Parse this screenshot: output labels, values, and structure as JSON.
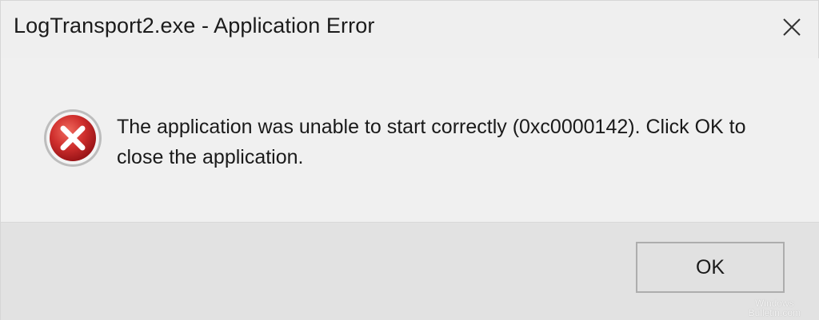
{
  "window": {
    "title": "LogTransport2.exe - Application Error"
  },
  "icons": {
    "close": "close-icon",
    "error": "error-icon"
  },
  "message": {
    "text": "The application was unable to start correctly (0xc0000142). Click OK to close the application."
  },
  "buttons": {
    "ok_label": "OK"
  },
  "watermark": {
    "line1": "Windows",
    "line2": "Bulletin.com"
  },
  "colors": {
    "error_red": "#c4272b",
    "dialog_bg": "#f0f0f0",
    "footer_bg": "#e2e2e2"
  }
}
